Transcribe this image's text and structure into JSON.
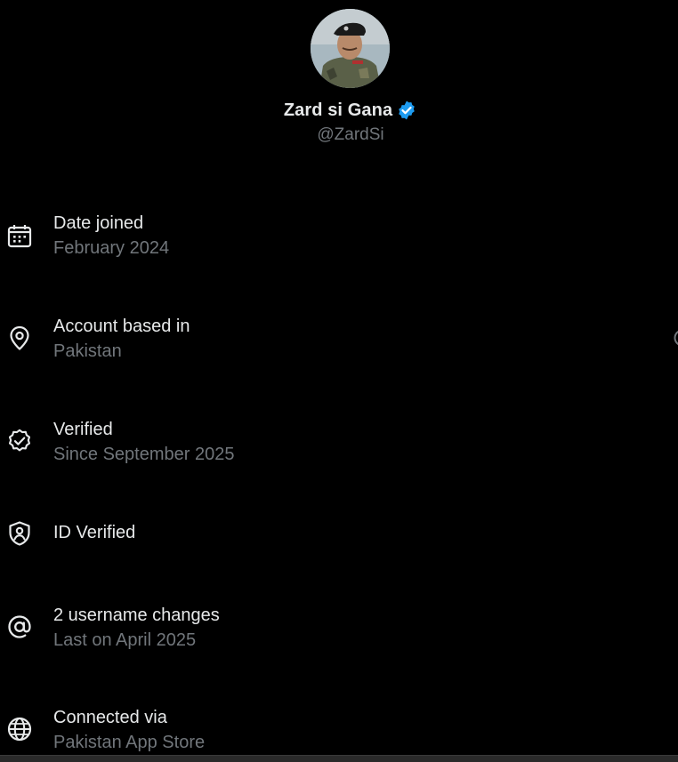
{
  "profile": {
    "display_name": "Zard si Gana",
    "handle": "@ZardSi",
    "verified_badge_color": "#1d9bf0"
  },
  "info_items": [
    {
      "icon": "calendar-icon",
      "title": "Date joined",
      "subtitle": "February 2024"
    },
    {
      "icon": "location-pin-icon",
      "title": "Account based in",
      "subtitle": "Pakistan"
    },
    {
      "icon": "verified-badge-outline-icon",
      "title": "Verified",
      "subtitle": "Since September 2025"
    },
    {
      "icon": "shield-user-icon",
      "title": "ID Verified",
      "subtitle": ""
    },
    {
      "icon": "at-sign-icon",
      "title": "2 username changes",
      "subtitle": "Last on April 2025"
    },
    {
      "icon": "globe-icon",
      "title": "Connected via",
      "subtitle": "Pakistan App Store"
    }
  ],
  "colors": {
    "background": "#000000",
    "primary_text": "#e7e9ea",
    "secondary_text": "#71767b",
    "accent": "#1d9bf0"
  }
}
